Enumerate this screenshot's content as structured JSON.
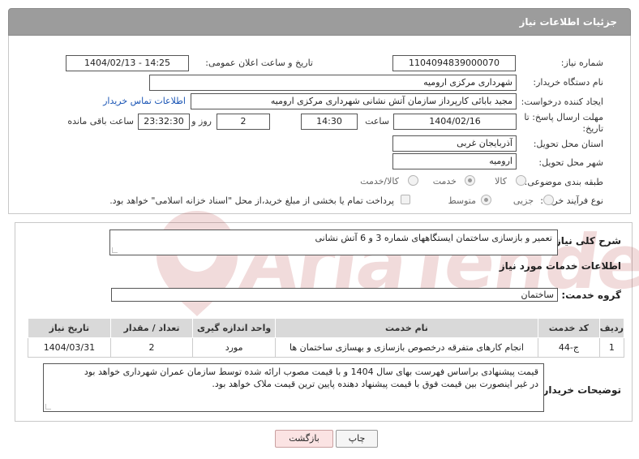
{
  "header": {
    "title": "جزئیات اطلاعات نیاز"
  },
  "form": {
    "need_number": {
      "label": "شماره نیاز:",
      "value": "1104094839000070"
    },
    "announce_datetime": {
      "label": "تاریخ و ساعت اعلان عمومی:",
      "value": "1404/02/13 - 14:25"
    },
    "buyer_org": {
      "label": "نام دستگاه خریدار:",
      "value": "شهرداری مرکزی ارومیه"
    },
    "requester": {
      "label": "ایجاد کننده درخواست:",
      "value": "مجید بابائی کارپرداز سازمان آتش نشانی شهرداری مرکزی ارومیه"
    },
    "contact_link": "اطلاعات تماس خریدار",
    "deadline": {
      "label_line1": "مهلت ارسال پاسخ: تا",
      "label_line2": "تاریخ:",
      "date": "1404/02/16",
      "time_label": "ساعت",
      "time": "14:30",
      "days": "2",
      "days_label": "روز و",
      "remaining": "23:32:30",
      "remaining_label": "ساعت باقی مانده"
    },
    "province": {
      "label": "استان محل تحویل:",
      "value": "آذربایجان غربی"
    },
    "city": {
      "label": "شهر محل تحویل:",
      "value": "ارومیه"
    },
    "category": {
      "label": "طبقه بندی موضوعی:",
      "options": [
        "کالا",
        "خدمت",
        "کالا/خدمت"
      ],
      "selected": "خدمت"
    },
    "process": {
      "label": "نوع فرآیند خرید :",
      "options": [
        "جزیی",
        "متوسط"
      ],
      "selected": "متوسط",
      "payment_note": "پرداخت تمام یا بخشی از مبلغ خرید،از محل \"اسناد خزانه اسلامی\" خواهد بود."
    }
  },
  "summary": {
    "label": "شرح کلی نیاز:",
    "value": "تعمیر و بازسازی ساختمان ایستگاههای شماره 3 و 6 آتش نشانی"
  },
  "services_title": "اطلاعات خدمات مورد نیاز",
  "service_group": {
    "label": "گروه خدمت:",
    "value": "ساختمان"
  },
  "table": {
    "headers": [
      "ردیف",
      "کد خدمت",
      "نام خدمت",
      "واحد اندازه گیری",
      "تعداد / مقدار",
      "تاریخ نیاز"
    ],
    "rows": [
      [
        "1",
        "ج-44",
        "انجام کارهای متفرقه درخصوص بازسازی و بهسازی ساختمان ها",
        "مورد",
        "2",
        "1404/03/31"
      ]
    ]
  },
  "buyer_notes": {
    "label": "توضیحات خریدار:",
    "line1": "قیمت پیشنهادی براساس فهرست بهای سال 1404 و با قیمت مصوب ارائه شده توسط سازمان عمران شهرداری خواهد بود",
    "line2": "در غیر اینصورت بین قیمت فوق با قیمت پیشنهاد دهنده پایین ترین قیمت ملاک خواهد بود."
  },
  "buttons": {
    "print": "چاپ",
    "back": "بازگشت"
  },
  "watermark": "AriaTender.net",
  "colors": {
    "header_bg": "#9c9c9c",
    "link": "#1a55b5",
    "back_button": "#fbe3e3"
  }
}
